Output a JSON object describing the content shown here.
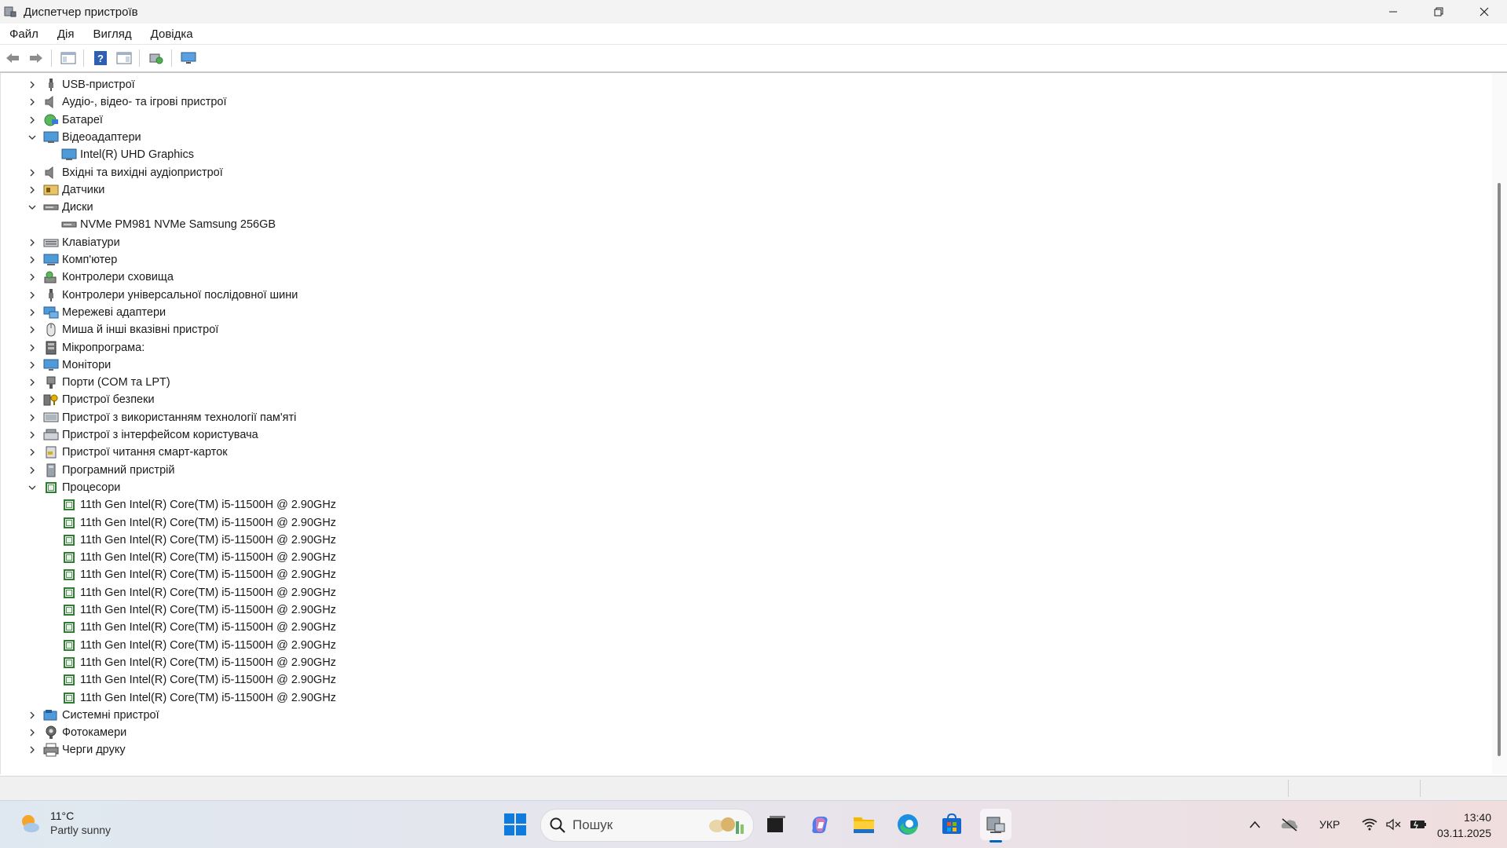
{
  "window": {
    "title": "Диспетчер пристроїв"
  },
  "menu": {
    "items": [
      "Файл",
      "Дія",
      "Вигляд",
      "Довідка"
    ]
  },
  "toolbar": {
    "buttons": [
      "back-arrow-icon",
      "forward-arrow-icon",
      "properties-pane-icon",
      "help-icon",
      "show-hide-console-tree-icon",
      "scan-hardware-icon",
      "monitor-icon"
    ]
  },
  "tree": {
    "items": [
      {
        "label": "USB-пристрої",
        "level": 0,
        "expanded": false,
        "icon": "usb-icon"
      },
      {
        "label": "Аудіо-, відео- та ігрові пристрої",
        "level": 0,
        "expanded": false,
        "icon": "speaker-icon"
      },
      {
        "label": "Батареї",
        "level": 0,
        "expanded": false,
        "icon": "battery-icon"
      },
      {
        "label": "Відеоадаптери",
        "level": 0,
        "expanded": true,
        "icon": "display-adapter-icon"
      },
      {
        "label": "Intel(R) UHD Graphics",
        "level": 1,
        "icon": "display-adapter-icon"
      },
      {
        "label": "Вхідні та вихідні аудіопристрої",
        "level": 0,
        "expanded": false,
        "icon": "speaker-icon"
      },
      {
        "label": "Датчики",
        "level": 0,
        "expanded": false,
        "icon": "sensor-icon"
      },
      {
        "label": "Диски",
        "level": 0,
        "expanded": true,
        "icon": "disk-drive-icon"
      },
      {
        "label": "NVMe PM981 NVMe Samsung 256GB",
        "level": 1,
        "icon": "disk-drive-icon"
      },
      {
        "label": "Клавіатури",
        "level": 0,
        "expanded": false,
        "icon": "keyboard-icon"
      },
      {
        "label": "Комп'ютер",
        "level": 0,
        "expanded": false,
        "icon": "computer-icon"
      },
      {
        "label": "Контролери сховища",
        "level": 0,
        "expanded": false,
        "icon": "storage-controller-icon"
      },
      {
        "label": "Контролери універсальної послідовної шини",
        "level": 0,
        "expanded": false,
        "icon": "usb-icon"
      },
      {
        "label": "Мережеві адаптери",
        "level": 0,
        "expanded": false,
        "icon": "network-adapter-icon"
      },
      {
        "label": "Миша й інші вказівні пристрої",
        "level": 0,
        "expanded": false,
        "icon": "mouse-icon"
      },
      {
        "label": "Мікропрограма:",
        "level": 0,
        "expanded": false,
        "icon": "firmware-icon"
      },
      {
        "label": "Монітори",
        "level": 0,
        "expanded": false,
        "icon": "monitor-icon"
      },
      {
        "label": "Порти (COM та LPT)",
        "level": 0,
        "expanded": false,
        "icon": "port-icon"
      },
      {
        "label": "Пристрої безпеки",
        "level": 0,
        "expanded": false,
        "icon": "security-device-icon"
      },
      {
        "label": "Пристрої з використанням технології пам'яті",
        "level": 0,
        "expanded": false,
        "icon": "memory-device-icon"
      },
      {
        "label": "Пристрої з інтерфейсом користувача",
        "level": 0,
        "expanded": false,
        "icon": "hid-icon"
      },
      {
        "label": "Пристрої читання смарт-карток",
        "level": 0,
        "expanded": false,
        "icon": "smart-card-reader-icon"
      },
      {
        "label": "Програмний пристрій",
        "level": 0,
        "expanded": false,
        "icon": "software-device-icon"
      },
      {
        "label": "Процесори",
        "level": 0,
        "expanded": true,
        "icon": "processor-icon"
      },
      {
        "label": "11th Gen Intel(R) Core(TM) i5-11500H @ 2.90GHz",
        "level": 1,
        "icon": "processor-icon"
      },
      {
        "label": "11th Gen Intel(R) Core(TM) i5-11500H @ 2.90GHz",
        "level": 1,
        "icon": "processor-icon"
      },
      {
        "label": "11th Gen Intel(R) Core(TM) i5-11500H @ 2.90GHz",
        "level": 1,
        "icon": "processor-icon"
      },
      {
        "label": "11th Gen Intel(R) Core(TM) i5-11500H @ 2.90GHz",
        "level": 1,
        "icon": "processor-icon"
      },
      {
        "label": "11th Gen Intel(R) Core(TM) i5-11500H @ 2.90GHz",
        "level": 1,
        "icon": "processor-icon"
      },
      {
        "label": "11th Gen Intel(R) Core(TM) i5-11500H @ 2.90GHz",
        "level": 1,
        "icon": "processor-icon"
      },
      {
        "label": "11th Gen Intel(R) Core(TM) i5-11500H @ 2.90GHz",
        "level": 1,
        "icon": "processor-icon"
      },
      {
        "label": "11th Gen Intel(R) Core(TM) i5-11500H @ 2.90GHz",
        "level": 1,
        "icon": "processor-icon"
      },
      {
        "label": "11th Gen Intel(R) Core(TM) i5-11500H @ 2.90GHz",
        "level": 1,
        "icon": "processor-icon"
      },
      {
        "label": "11th Gen Intel(R) Core(TM) i5-11500H @ 2.90GHz",
        "level": 1,
        "icon": "processor-icon"
      },
      {
        "label": "11th Gen Intel(R) Core(TM) i5-11500H @ 2.90GHz",
        "level": 1,
        "icon": "processor-icon"
      },
      {
        "label": "11th Gen Intel(R) Core(TM) i5-11500H @ 2.90GHz",
        "level": 1,
        "icon": "processor-icon"
      },
      {
        "label": "Системні пристрої",
        "level": 0,
        "expanded": false,
        "icon": "system-device-icon"
      },
      {
        "label": "Фотокамери",
        "level": 0,
        "expanded": false,
        "icon": "camera-icon"
      },
      {
        "label": "Черги друку",
        "level": 0,
        "expanded": false,
        "icon": "printer-icon"
      }
    ]
  },
  "taskbar": {
    "weather": {
      "temp": "11°C",
      "condition": "Partly sunny"
    },
    "search": {
      "placeholder": "Пошук"
    },
    "apps": [
      "start-icon",
      "task-view-icon",
      "copilot-icon",
      "file-explorer-icon",
      "edge-icon",
      "store-icon",
      "device-manager-icon"
    ],
    "tray": {
      "language": "УКР",
      "time": "13:40",
      "date": "03.11.2025"
    }
  },
  "colors": {
    "accent": "#0067c0",
    "processor_green": "#2e7d32"
  }
}
